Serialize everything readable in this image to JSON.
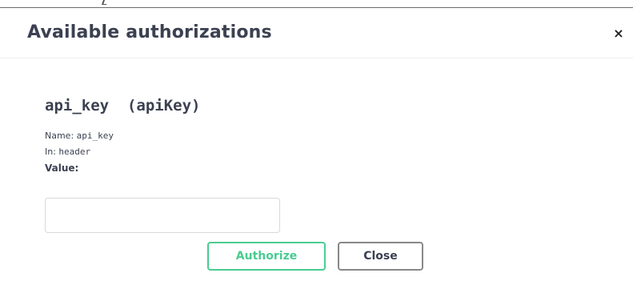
{
  "modal": {
    "title": "Available authorizations",
    "close_glyph": "×"
  },
  "auth": {
    "heading": "api_key  (apiKey)",
    "name_label": "Name:",
    "name_value": "api_key",
    "in_label": "In:",
    "in_value": "header",
    "value_label": "Value:",
    "value_input": ""
  },
  "buttons": {
    "authorize": "Authorize",
    "close": "Close"
  },
  "colors": {
    "authorize_accent": "#49cc90",
    "text": "#3b4151"
  },
  "icons": {
    "close": "close-icon"
  }
}
